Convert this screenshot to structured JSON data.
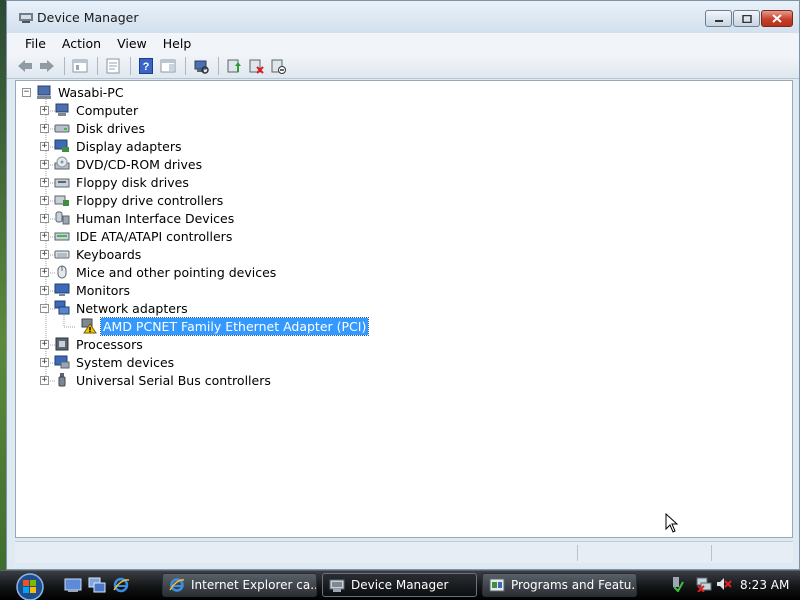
{
  "window": {
    "title": "Device Manager",
    "controls": {
      "minimize": "minimize",
      "maximize": "maximize",
      "close": "close"
    }
  },
  "menu": [
    "File",
    "Action",
    "View",
    "Help"
  ],
  "toolbar": {
    "buttons": [
      "back-icon",
      "forward-icon",
      "console-tree-icon",
      "properties-icon",
      "help-icon",
      "action-pane-icon",
      "scan-hardware-icon",
      "update-driver-icon",
      "uninstall-icon",
      "disable-icon"
    ]
  },
  "tree": {
    "root": {
      "label": "Wasabi-PC"
    },
    "categories": [
      {
        "label": "Computer",
        "icon": "computer-icon",
        "expanded": false
      },
      {
        "label": "Disk drives",
        "icon": "disk-drive-icon",
        "expanded": false
      },
      {
        "label": "Display adapters",
        "icon": "display-adapter-icon",
        "expanded": false
      },
      {
        "label": "DVD/CD-ROM drives",
        "icon": "dvd-drive-icon",
        "expanded": false
      },
      {
        "label": "Floppy disk drives",
        "icon": "floppy-drive-icon",
        "expanded": false
      },
      {
        "label": "Floppy drive controllers",
        "icon": "floppy-controller-icon",
        "expanded": false
      },
      {
        "label": "Human Interface Devices",
        "icon": "hid-icon",
        "expanded": false
      },
      {
        "label": "IDE ATA/ATAPI controllers",
        "icon": "ide-controller-icon",
        "expanded": false
      },
      {
        "label": "Keyboards",
        "icon": "keyboard-icon",
        "expanded": false
      },
      {
        "label": "Mice and other pointing devices",
        "icon": "mouse-icon",
        "expanded": false
      },
      {
        "label": "Monitors",
        "icon": "monitor-icon",
        "expanded": false
      },
      {
        "label": "Network adapters",
        "icon": "network-adapter-icon",
        "expanded": true
      },
      {
        "label": "AMD PCNET Family Ethernet Adapter (PCI)",
        "icon": "warning-device-icon",
        "child": true,
        "selected": true
      },
      {
        "label": "Processors",
        "icon": "processor-icon",
        "expanded": false
      },
      {
        "label": "System devices",
        "icon": "system-device-icon",
        "expanded": false
      },
      {
        "label": "Universal Serial Bus controllers",
        "icon": "usb-icon",
        "expanded": false
      }
    ]
  },
  "taskbar": {
    "quick_launch": [
      "show-desktop-icon",
      "switch-windows-icon",
      "internet-explorer-icon"
    ],
    "tasks": [
      {
        "label": "Internet Explorer ca...",
        "icon": "internet-explorer-icon",
        "active": false
      },
      {
        "label": "Device Manager",
        "icon": "device-manager-icon",
        "active": true
      },
      {
        "label": "Programs and Featu...",
        "icon": "programs-icon",
        "active": false
      }
    ],
    "tray": [
      "safely-remove-icon",
      "network-disconnected-icon",
      "volume-muted-icon"
    ],
    "clock": "8:23 AM"
  },
  "colors": {
    "selection": "#3399ff",
    "close_button": "#c4402a",
    "taskbar": "#121416"
  }
}
